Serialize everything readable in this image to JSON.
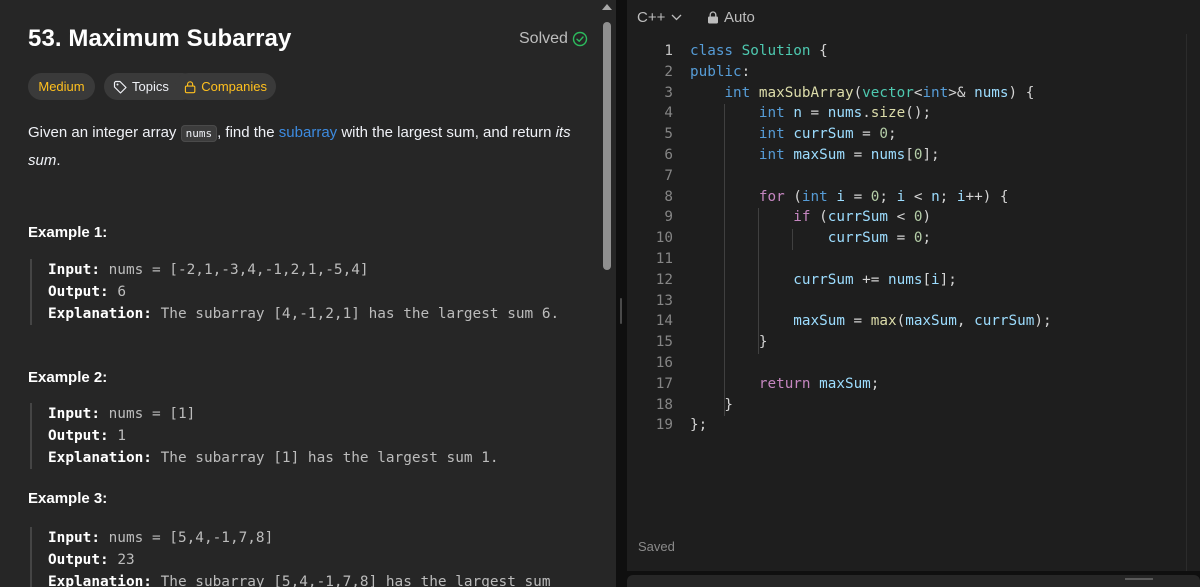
{
  "problem": {
    "title": "53. Maximum Subarray",
    "status": "Solved",
    "tags": {
      "difficulty": "Medium",
      "topics": "Topics",
      "companies": "Companies"
    },
    "statement": {
      "part1": "Given an integer array ",
      "code": "nums",
      "part2": ", find the ",
      "link": "subarray",
      "part3": " with the largest sum, and return ",
      "emphasis": "its sum",
      "part4": "."
    },
    "examples": [
      {
        "heading": "Example 1:",
        "input_label": "Input:",
        "input": " nums = [-2,1,-3,4,-1,2,1,-5,4]",
        "output_label": "Output:",
        "output": " 6",
        "explanation_label": "Explanation:",
        "explanation": " The subarray [4,-1,2,1] has the largest sum 6."
      },
      {
        "heading": "Example 2:",
        "input_label": "Input:",
        "input": " nums = [1]",
        "output_label": "Output:",
        "output": " 1",
        "explanation_label": "Explanation:",
        "explanation": " The subarray [1] has the largest sum 1."
      },
      {
        "heading": "Example 3:",
        "input_label": "Input:",
        "input": " nums = [5,4,-1,7,8]",
        "output_label": "Output:",
        "output": " 23",
        "explanation_label": "Explanation:",
        "explanation": " The subarray [5,4,-1,7,8] has the largest sum"
      }
    ]
  },
  "editor": {
    "language": "C++",
    "mode": "Auto",
    "status": "Saved",
    "lines": [
      {
        "n": "1",
        "tokens": [
          [
            "kw",
            "class"
          ],
          [
            "pun",
            " "
          ],
          [
            "ty",
            "Solution"
          ],
          [
            "pun",
            " {"
          ]
        ]
      },
      {
        "n": "2",
        "tokens": [
          [
            "kw",
            "public"
          ],
          [
            "pun",
            ":"
          ]
        ]
      },
      {
        "n": "3",
        "tokens": [
          [
            "pun",
            "    "
          ],
          [
            "kw",
            "int"
          ],
          [
            "pun",
            " "
          ],
          [
            "fn",
            "maxSubArray"
          ],
          [
            "pun",
            "("
          ],
          [
            "ty",
            "vector"
          ],
          [
            "pun",
            "<"
          ],
          [
            "kw",
            "int"
          ],
          [
            "pun",
            ">& "
          ],
          [
            "var",
            "nums"
          ],
          [
            "pun",
            ") {"
          ]
        ]
      },
      {
        "n": "4",
        "tokens": [
          [
            "pun",
            "        "
          ],
          [
            "kw",
            "int"
          ],
          [
            "pun",
            " "
          ],
          [
            "var",
            "n"
          ],
          [
            "pun",
            " = "
          ],
          [
            "var",
            "nums"
          ],
          [
            "pun",
            "."
          ],
          [
            "fn",
            "size"
          ],
          [
            "pun",
            "();"
          ]
        ]
      },
      {
        "n": "5",
        "tokens": [
          [
            "pun",
            "        "
          ],
          [
            "kw",
            "int"
          ],
          [
            "pun",
            " "
          ],
          [
            "var",
            "currSum"
          ],
          [
            "pun",
            " = "
          ],
          [
            "num",
            "0"
          ],
          [
            "pun",
            ";"
          ]
        ]
      },
      {
        "n": "6",
        "tokens": [
          [
            "pun",
            "        "
          ],
          [
            "kw",
            "int"
          ],
          [
            "pun",
            " "
          ],
          [
            "var",
            "maxSum"
          ],
          [
            "pun",
            " = "
          ],
          [
            "var",
            "nums"
          ],
          [
            "pun",
            "["
          ],
          [
            "num",
            "0"
          ],
          [
            "pun",
            "];"
          ]
        ]
      },
      {
        "n": "7",
        "tokens": []
      },
      {
        "n": "8",
        "tokens": [
          [
            "pun",
            "        "
          ],
          [
            "ctl",
            "for"
          ],
          [
            "pun",
            " ("
          ],
          [
            "kw",
            "int"
          ],
          [
            "pun",
            " "
          ],
          [
            "var",
            "i"
          ],
          [
            "pun",
            " = "
          ],
          [
            "num",
            "0"
          ],
          [
            "pun",
            "; "
          ],
          [
            "var",
            "i"
          ],
          [
            "pun",
            " < "
          ],
          [
            "var",
            "n"
          ],
          [
            "pun",
            "; "
          ],
          [
            "var",
            "i"
          ],
          [
            "pun",
            "++) {"
          ]
        ]
      },
      {
        "n": "9",
        "tokens": [
          [
            "pun",
            "            "
          ],
          [
            "ctl",
            "if"
          ],
          [
            "pun",
            " ("
          ],
          [
            "var",
            "currSum"
          ],
          [
            "pun",
            " < "
          ],
          [
            "num",
            "0"
          ],
          [
            "pun",
            ")"
          ]
        ]
      },
      {
        "n": "10",
        "tokens": [
          [
            "pun",
            "                "
          ],
          [
            "var",
            "currSum"
          ],
          [
            "pun",
            " = "
          ],
          [
            "num",
            "0"
          ],
          [
            "pun",
            ";"
          ]
        ]
      },
      {
        "n": "11",
        "tokens": []
      },
      {
        "n": "12",
        "tokens": [
          [
            "pun",
            "            "
          ],
          [
            "var",
            "currSum"
          ],
          [
            "pun",
            " += "
          ],
          [
            "var",
            "nums"
          ],
          [
            "pun",
            "["
          ],
          [
            "var",
            "i"
          ],
          [
            "pun",
            "];"
          ]
        ]
      },
      {
        "n": "13",
        "tokens": []
      },
      {
        "n": "14",
        "tokens": [
          [
            "pun",
            "            "
          ],
          [
            "var",
            "maxSum"
          ],
          [
            "pun",
            " = "
          ],
          [
            "fn",
            "max"
          ],
          [
            "pun",
            "("
          ],
          [
            "var",
            "maxSum"
          ],
          [
            "pun",
            ", "
          ],
          [
            "var",
            "currSum"
          ],
          [
            "pun",
            ");"
          ]
        ]
      },
      {
        "n": "15",
        "tokens": [
          [
            "pun",
            "        }"
          ]
        ]
      },
      {
        "n": "16",
        "tokens": []
      },
      {
        "n": "17",
        "tokens": [
          [
            "pun",
            "        "
          ],
          [
            "ctl",
            "return"
          ],
          [
            "pun",
            " "
          ],
          [
            "var",
            "maxSum"
          ],
          [
            "pun",
            ";"
          ]
        ]
      },
      {
        "n": "18",
        "tokens": [
          [
            "pun",
            "    }"
          ]
        ]
      },
      {
        "n": "19",
        "tokens": [
          [
            "pun",
            "};"
          ]
        ]
      }
    ]
  },
  "colors": {
    "accent_link": "#3d8be0",
    "difficulty_medium": "#ffc01e",
    "solved_check": "#2cbb5d"
  }
}
